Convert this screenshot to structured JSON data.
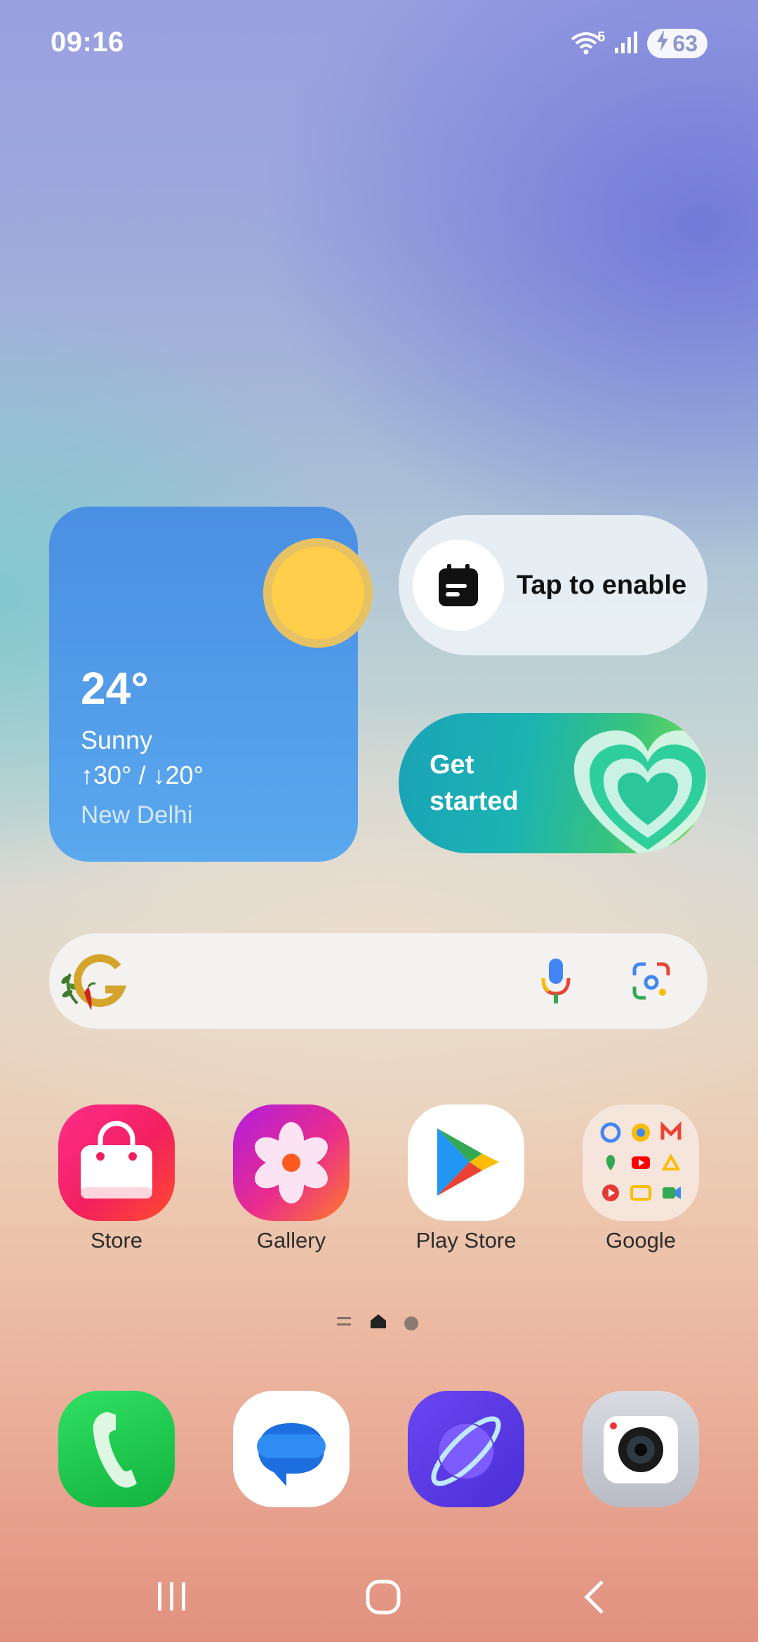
{
  "status_bar": {
    "time": "09:16",
    "wifi_badge": "5",
    "battery": "63"
  },
  "weather": {
    "temp": "24°",
    "condition": "Sunny",
    "range": "↑30° / ↓20°",
    "city": "New Delhi"
  },
  "widgets": {
    "enable_label": "Tap to enable",
    "get_started_line1": "Get",
    "get_started_line2": "started"
  },
  "apps": [
    {
      "label": "Store",
      "icon": "store-bag-icon"
    },
    {
      "label": "Gallery",
      "icon": "gallery-flower-icon"
    },
    {
      "label": "Play Store",
      "icon": "play-store-icon"
    },
    {
      "label": "Google",
      "icon": "google-folder-icon"
    }
  ],
  "dock": [
    {
      "icon": "phone-icon"
    },
    {
      "icon": "messages-icon"
    },
    {
      "icon": "internet-icon"
    },
    {
      "icon": "camera-icon"
    }
  ],
  "pager": {
    "current": "home"
  },
  "colors": {
    "weather_bg": "#4a8fe3",
    "sun": "#ffce4a",
    "store": "#f2205f",
    "phone": "#1fcf4a"
  }
}
